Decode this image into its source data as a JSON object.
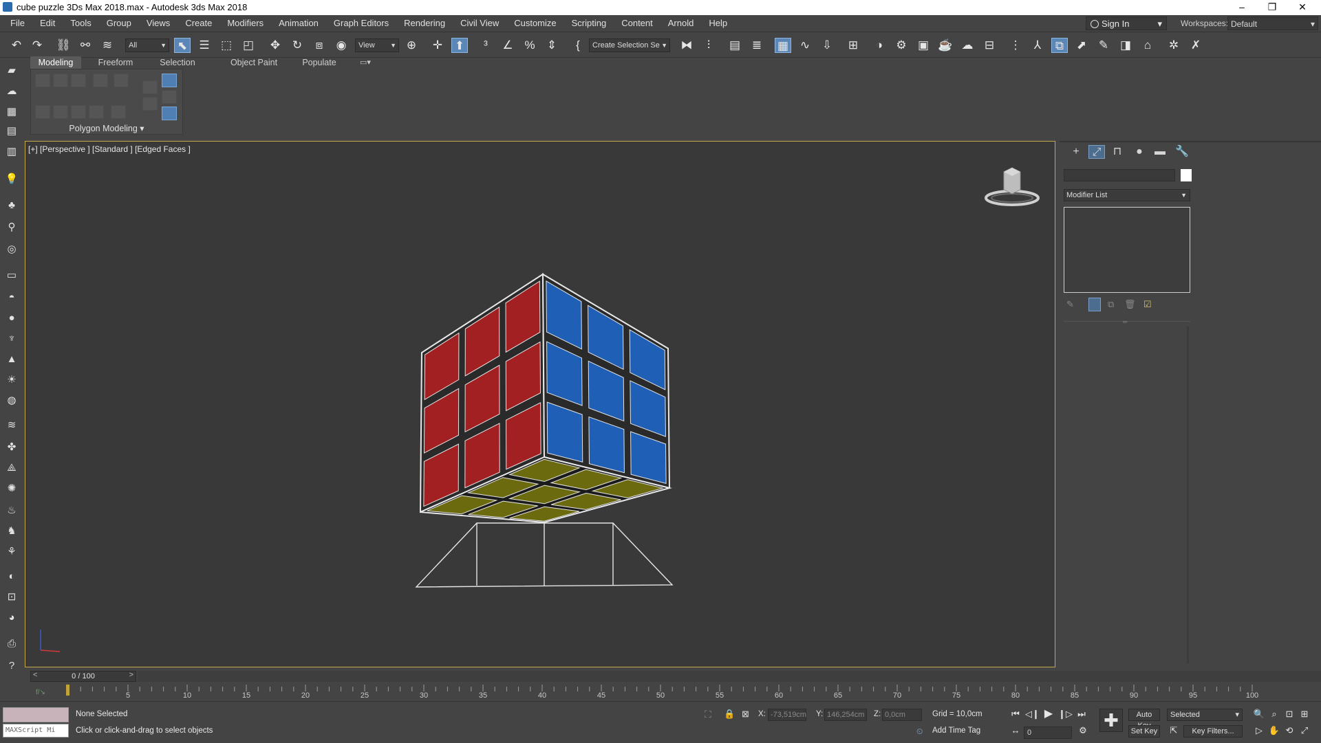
{
  "window": {
    "title": "cube puzzle 3Ds Max 2018.max - Autodesk 3ds Max 2018",
    "minimize": "–",
    "restore": "❐",
    "close": "✕"
  },
  "menu": {
    "items": [
      "File",
      "Edit",
      "Tools",
      "Group",
      "Views",
      "Create",
      "Modifiers",
      "Animation",
      "Graph Editors",
      "Rendering",
      "Civil View",
      "Customize",
      "Scripting",
      "Content",
      "Arnold",
      "Help"
    ],
    "sign_in": "Sign In",
    "workspaces_label": "Workspaces:",
    "workspace_value": "Default"
  },
  "toolbar": {
    "selection_filter": "All",
    "reference_coord": "View",
    "named_selection": "Create Selection Se"
  },
  "ribbon": {
    "tabs": [
      "Modeling",
      "Freeform",
      "Selection",
      "Object Paint",
      "Populate"
    ],
    "active_tab": "Modeling",
    "panel_label": "Polygon Modeling"
  },
  "viewport": {
    "label": "[+] [Perspective ] [Standard ] [Edged Faces ]",
    "cube_colors": {
      "left_face": "#a32022",
      "right_face": "#1f5fb5",
      "bottom_face": "#6b6a0e",
      "background": "#393939",
      "border": "#c9a84a"
    }
  },
  "command_panel": {
    "modifier_list": "Modifier List"
  },
  "timeline": {
    "slider_label": "0 / 100",
    "ticks": [
      "5",
      "10",
      "15",
      "20",
      "25",
      "30",
      "35",
      "40",
      "45",
      "50",
      "55",
      "60",
      "65",
      "70",
      "75",
      "80",
      "85",
      "90",
      "95",
      "100"
    ]
  },
  "status": {
    "maxscript_placeholder": "MAXScript Mi",
    "selection": "None Selected",
    "prompt": "Click or click-and-drag to select objects",
    "x_label": "X:",
    "x_value": "-73,519cm",
    "y_label": "Y:",
    "y_value": "146,254cm",
    "z_label": "Z:",
    "z_value": "0,0cm",
    "grid": "Grid = 10,0cm",
    "add_time_tag": "Add Time Tag",
    "auto_key": "Auto Key",
    "set_key": "Set Key",
    "key_mode": "Selected",
    "key_filters": "Key Filters...",
    "current_frame": "0"
  }
}
